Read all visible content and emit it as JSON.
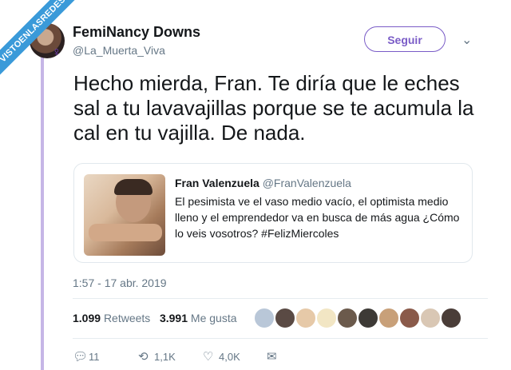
{
  "watermark": "VISTOENLASREDES",
  "author": {
    "name": "FemiNancy Downs",
    "handle": "@La_Muerta_Viva"
  },
  "follow_label": "Seguir",
  "tweet": {
    "text": "Hecho mierda, Fran. Te diría que le eches sal a tu lavavajillas porque se te acumula la cal en tu vajilla. De nada."
  },
  "quoted": {
    "name": "Fran Valenzuela",
    "handle": "@FranValenzuela",
    "text": "El pesimista ve el vaso medio vacío, el optimista medio lleno y el emprendedor va en busca de más agua ¿Cómo lo veis vosotros? #FelizMiercoles"
  },
  "timestamp": "1:57 - 17 abr. 2019",
  "stats": {
    "retweets_count": "1.099",
    "retweets_label": "Retweets",
    "likes_count": "3.991",
    "likes_label": "Me gusta"
  },
  "likers": [
    "#b9c7d8",
    "#5a4a44",
    "#e6c9a8",
    "#f2e6c4",
    "#6b5a4c",
    "#3d3a36",
    "#c8a079",
    "#8a5a4a",
    "#d9c7b4",
    "#4a3d38"
  ],
  "actions": {
    "replies": "11",
    "retweets": "1,1K",
    "likes": "4,0K"
  },
  "icons": {
    "reply": "reply-icon",
    "retweet": "retweet-icon",
    "like": "heart-icon",
    "message": "envelope-icon",
    "more": "chevron-down-icon"
  }
}
